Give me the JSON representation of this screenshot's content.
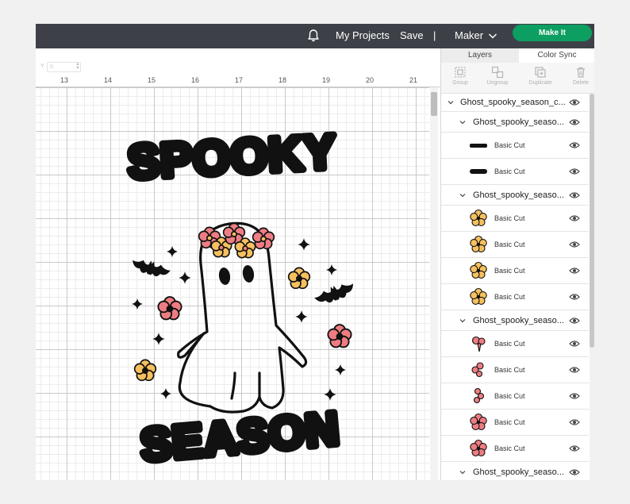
{
  "topbar": {
    "my_projects": "My Projects",
    "save": "Save",
    "separator": "|",
    "machine": "Maker",
    "make_it": "Make It",
    "bg_color": "#3d4147",
    "make_it_color": "#0d9e62"
  },
  "canvas": {
    "y_label": "Y",
    "y_value": "0",
    "ruler_ticks": [
      "13",
      "14",
      "15",
      "16",
      "17",
      "18",
      "19",
      "20",
      "21"
    ],
    "artwork": {
      "word_top": "SPOOKY",
      "word_bottom": "SEASON",
      "pink": "#ee7d83",
      "yellow": "#f6c05f",
      "ink": "#111111"
    }
  },
  "panel": {
    "tabs": [
      "Layers",
      "Color Sync"
    ],
    "tools": [
      "Group",
      "Ungroup",
      "Duplicate",
      "Delete"
    ],
    "root_group": "Ghost_spooky_season_c...",
    "groups": [
      {
        "name": "Ghost_spooky_seaso...",
        "layers": [
          {
            "label": "Basic Cut",
            "icon": "season-text-thumbnail"
          },
          {
            "label": "Basic Cut",
            "icon": "spooky-text-thumbnail"
          }
        ]
      },
      {
        "name": "Ghost_spooky_seaso...",
        "layers": [
          {
            "label": "Basic Cut",
            "icon": "yellow-flower-thumbnail"
          },
          {
            "label": "Basic Cut",
            "icon": "yellow-flower-thumbnail"
          },
          {
            "label": "Basic Cut",
            "icon": "yellow-flower-thumbnail"
          },
          {
            "label": "Basic Cut",
            "icon": "yellow-flower-thumbnail"
          }
        ]
      },
      {
        "name": "Ghost_spooky_seaso...",
        "layers": [
          {
            "label": "Basic Cut",
            "icon": "pink-petal-thumbnail"
          },
          {
            "label": "Basic Cut",
            "icon": "pink-petal-thumbnail"
          },
          {
            "label": "Basic Cut",
            "icon": "pink-petal-thumbnail"
          },
          {
            "label": "Basic Cut",
            "icon": "pink-flower-thumbnail"
          },
          {
            "label": "Basic Cut",
            "icon": "pink-flower-thumbnail"
          }
        ]
      },
      {
        "name": "Ghost_spooky_seaso...",
        "layers": []
      }
    ]
  }
}
